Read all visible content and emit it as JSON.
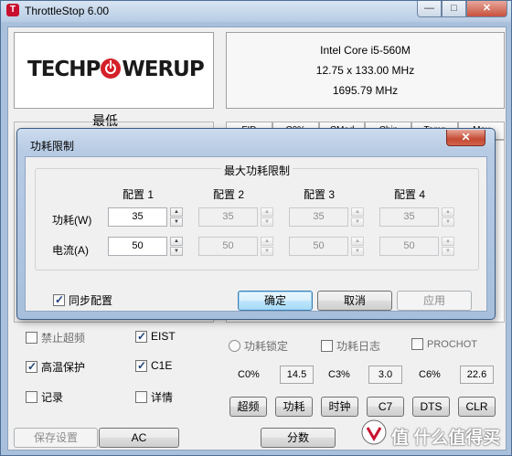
{
  "app": {
    "title": "ThrottleStop 6.00",
    "window_buttons": {
      "minimize": "—",
      "restore": "□",
      "close": "✕"
    },
    "logo": {
      "part1": "TECHP",
      "part2": "WERUP"
    },
    "cpu": {
      "name": "Intel Core i5-560M",
      "multiplier": "12.75 x 133.00 MHz",
      "frequency": "1695.79 MHz"
    },
    "profile_label": "最低",
    "table_headers": [
      "FID",
      "C0%",
      "CMod",
      "Chip",
      "Temp",
      "Max"
    ],
    "options": {
      "disable_turbo": "禁止超频",
      "eist": "EIST",
      "bd_prochot": "高温保护",
      "c1e": "C1E",
      "log": "记录",
      "details": "详情",
      "power_lock": "功耗锁定",
      "power_log": "功耗日志",
      "prochot": "PROCHOT"
    },
    "stats": {
      "c0_label": "C0%",
      "c0_value": "14.5",
      "c3_label": "C3%",
      "c3_value": "3.0",
      "c6_label": "C6%",
      "c6_value": "22.6"
    },
    "buttons": {
      "turbo": "超频",
      "power": "功耗",
      "clock": "时钟",
      "c7": "C7",
      "dts": "DTS",
      "clr": "CLR",
      "save": "保存设置",
      "ac": "AC",
      "score": "分数"
    },
    "watermark": "值 什么值得买"
  },
  "dialog": {
    "title": "功耗限制",
    "close": "✕",
    "group_title": "最大功耗限制",
    "config_labels": [
      "配置 1",
      "配置 2",
      "配置 3",
      "配置 4"
    ],
    "row_power": "功耗(W)",
    "row_current": "电流(A)",
    "power_values": [
      "35",
      "35",
      "35",
      "35"
    ],
    "current_values": [
      "50",
      "50",
      "50",
      "50"
    ],
    "sync_label": "同步配置",
    "ok": "确定",
    "cancel": "取消",
    "apply": "应用"
  },
  "colors": {
    "accent": "#c8102e",
    "dialog_frame": "#a7bfdc"
  }
}
